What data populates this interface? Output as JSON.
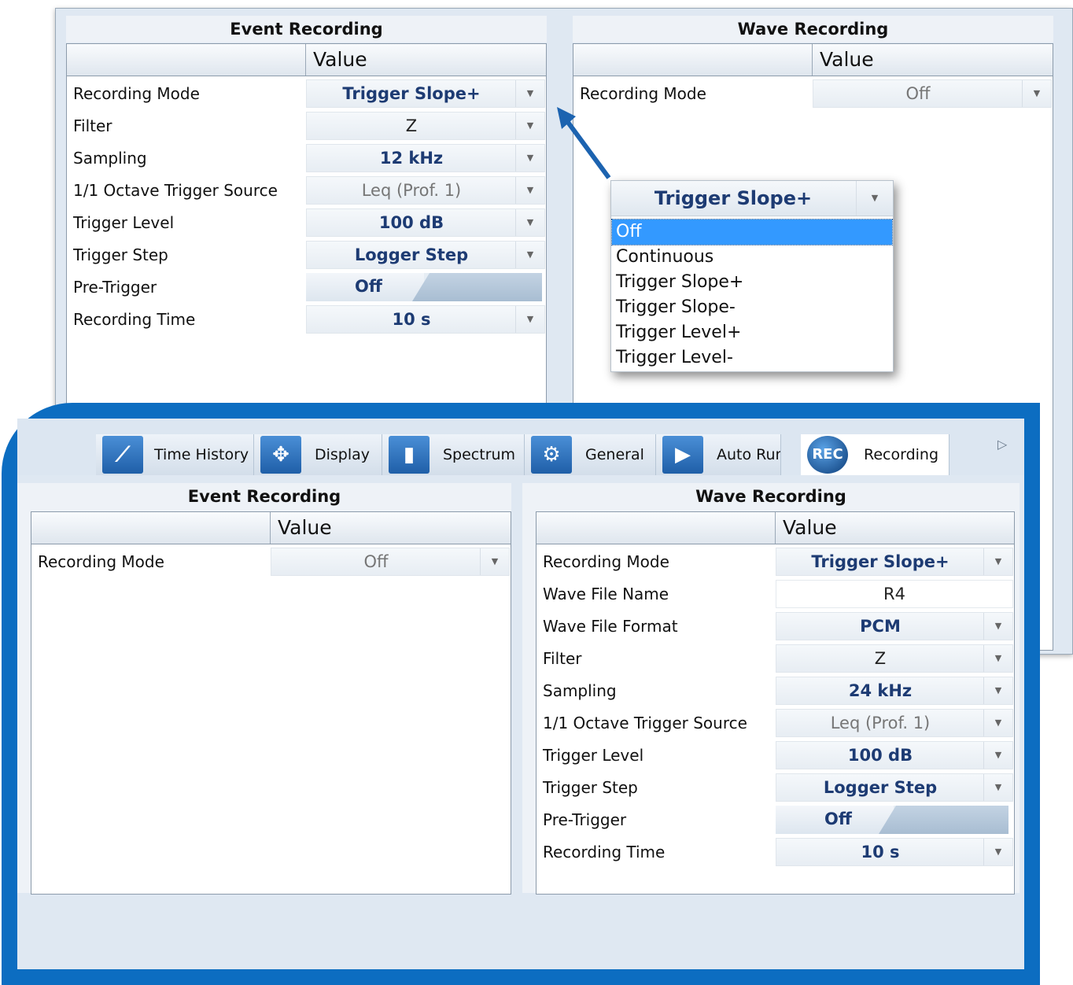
{
  "top_left": {
    "title": "Event Recording",
    "value_header": "Value",
    "rows": [
      {
        "label": "Recording Mode",
        "value": "Trigger Slope+"
      },
      {
        "label": "Filter",
        "value": "Z"
      },
      {
        "label": "Sampling",
        "value": "12 kHz"
      },
      {
        "label": "1/1 Octave Trigger Source",
        "value": "Leq (Prof. 1)"
      },
      {
        "label": "Trigger Level",
        "value": "100 dB"
      },
      {
        "label": "Trigger Step",
        "value": "Logger Step"
      },
      {
        "label": "Pre-Trigger",
        "value": "Off"
      },
      {
        "label": "Recording Time",
        "value": "10 s"
      }
    ]
  },
  "top_right": {
    "title": "Wave Recording",
    "value_header": "Value",
    "rows": [
      {
        "label": "Recording Mode",
        "value": "Off"
      }
    ]
  },
  "dropdown": {
    "current": "Trigger Slope+",
    "options": [
      "Off",
      "Continuous",
      "Trigger Slope+",
      "Trigger Slope-",
      "Trigger Level+",
      "Trigger Level-"
    ],
    "highlighted": "Off"
  },
  "tabs": [
    {
      "label": "Time History",
      "icon": "time-history-icon"
    },
    {
      "label": "Display",
      "icon": "display-icon"
    },
    {
      "label": "Spectrum",
      "icon": "spectrum-icon"
    },
    {
      "label": "General",
      "icon": "general-icon"
    },
    {
      "label": "Auto Run",
      "icon": "auto-run-icon"
    },
    {
      "label": "Recording",
      "icon": "rec-icon",
      "icon_text": "REC",
      "active": true
    }
  ],
  "bottom_left": {
    "title": "Event Recording",
    "value_header": "Value",
    "rows": [
      {
        "label": "Recording Mode",
        "value": "Off"
      }
    ]
  },
  "bottom_right": {
    "title": "Wave Recording",
    "value_header": "Value",
    "rows": [
      {
        "label": "Recording Mode",
        "value": "Trigger Slope+"
      },
      {
        "label": "Wave File Name",
        "value": "R4"
      },
      {
        "label": "Wave File Format",
        "value": "PCM"
      },
      {
        "label": "Filter",
        "value": "Z"
      },
      {
        "label": "Sampling",
        "value": "24 kHz"
      },
      {
        "label": "1/1 Octave Trigger Source",
        "value": "Leq (Prof. 1)"
      },
      {
        "label": "Trigger Level",
        "value": "100 dB"
      },
      {
        "label": "Trigger Step",
        "value": "Logger Step"
      },
      {
        "label": "Pre-Trigger",
        "value": "Off"
      },
      {
        "label": "Recording Time",
        "value": "10 s"
      }
    ]
  },
  "colors": {
    "accent_frame": "#0c6dc1",
    "value_text": "#1d3b73",
    "selection": "#3399ff"
  }
}
